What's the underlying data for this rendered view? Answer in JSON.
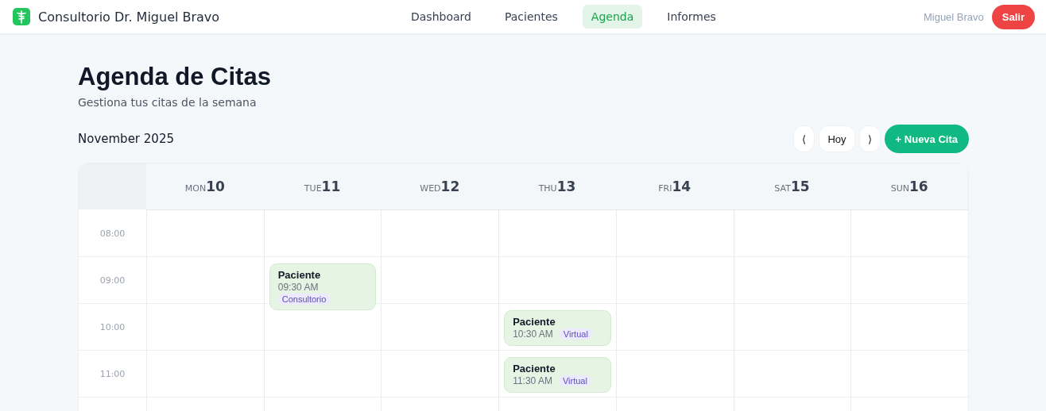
{
  "navbar": {
    "brand": "Consultorio Dr. Miguel Bravo",
    "tabs": [
      {
        "label": "Dashboard",
        "selected": false
      },
      {
        "label": "Pacientes",
        "selected": false
      },
      {
        "label": "Agenda",
        "selected": true
      },
      {
        "label": "Informes",
        "selected": false
      }
    ],
    "user": "Miguel Bravo",
    "logout": "Salir"
  },
  "page": {
    "title": "Agenda de Citas",
    "subtitle": "Gestiona tus citas de la semana",
    "month": "November 2025",
    "prev": "⟨",
    "today": "Hoy",
    "next": "⟩",
    "new_button": "+ Nueva Cita"
  },
  "calendar": {
    "days": [
      {
        "weekday": "MON",
        "date": "10"
      },
      {
        "weekday": "TUE",
        "date": "11"
      },
      {
        "weekday": "WED",
        "date": "12"
      },
      {
        "weekday": "THU",
        "date": "13"
      },
      {
        "weekday": "FRI",
        "date": "14"
      },
      {
        "weekday": "SAT",
        "date": "15"
      },
      {
        "weekday": "SUN",
        "date": "16"
      }
    ],
    "rows": [
      {
        "time": "08:00",
        "cells": [
          null,
          null,
          null,
          null,
          null,
          null,
          null
        ]
      },
      {
        "time": "09:00",
        "cells": [
          null,
          {
            "patient": "Paciente",
            "time": "09:30 AM",
            "type": "Consultorio"
          },
          null,
          null,
          null,
          null,
          null
        ]
      },
      {
        "time": "10:00",
        "cells": [
          null,
          null,
          null,
          {
            "patient": "Paciente",
            "time": "10:30 AM",
            "type": "Virtual"
          },
          null,
          null,
          null
        ]
      },
      {
        "time": "11:00",
        "cells": [
          null,
          null,
          null,
          {
            "patient": "Paciente",
            "time": "11:30 AM",
            "type": "Virtual"
          },
          null,
          null,
          null
        ]
      }
    ]
  }
}
